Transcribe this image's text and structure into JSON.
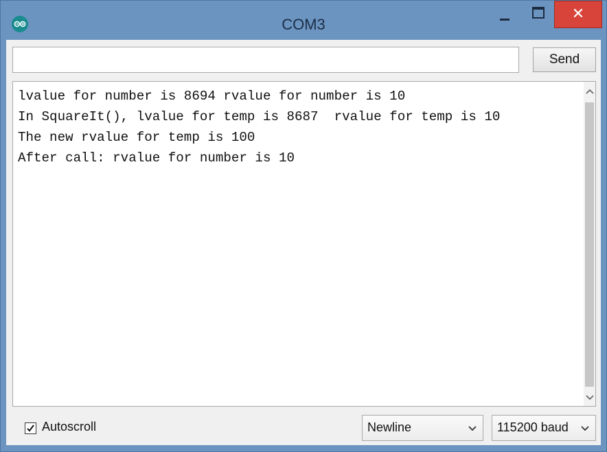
{
  "window": {
    "title": "COM3",
    "close_glyph": "✕",
    "icons": {
      "app": "arduino-icon",
      "minimize": "minimize-icon",
      "maximize": "maximize-icon",
      "close": "close-icon"
    },
    "colors": {
      "titlebar": "#6b94c1",
      "close_button": "#d9443a"
    }
  },
  "input_bar": {
    "value": "",
    "send_label": "Send"
  },
  "output": {
    "lines": [
      "lvalue for number is 8694 rvalue for number is 10",
      "In SquareIt(), lvalue for temp is 8687  rvalue for temp is 10",
      "The new rvalue for temp is 100",
      "After call: rvalue for number is 10"
    ]
  },
  "footer": {
    "autoscroll_label": "Autoscroll",
    "autoscroll_checked": true,
    "line_ending": "Newline",
    "baud_rate": "115200 baud"
  }
}
